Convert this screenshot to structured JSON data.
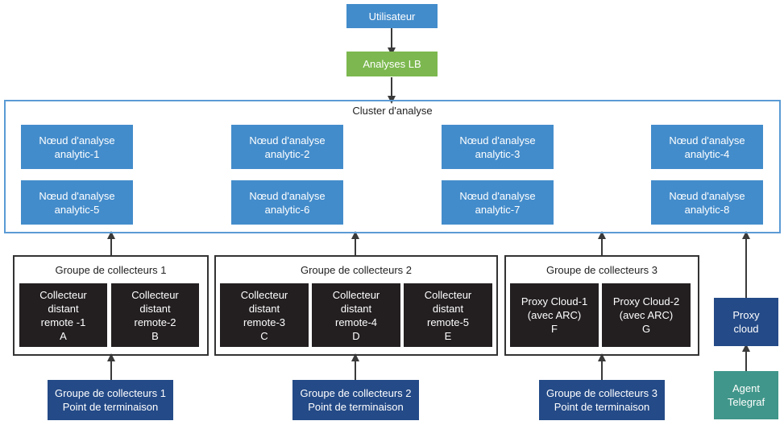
{
  "user": {
    "label": "Utilisateur"
  },
  "load_balancer": {
    "label": "Analyses LB"
  },
  "cluster": {
    "title": "Cluster d'analyse",
    "nodes": [
      {
        "line1": "Nœud d'analyse",
        "line2": "analytic-1"
      },
      {
        "line1": "Nœud d'analyse",
        "line2": "analytic-2"
      },
      {
        "line1": "Nœud d'analyse",
        "line2": "analytic-3"
      },
      {
        "line1": "Nœud d'analyse",
        "line2": "analytic-4"
      },
      {
        "line1": "Nœud d'analyse",
        "line2": "analytic-5"
      },
      {
        "line1": "Nœud d'analyse",
        "line2": "analytic-6"
      },
      {
        "line1": "Nœud d'analyse",
        "line2": "analytic-7"
      },
      {
        "line1": "Nœud d'analyse",
        "line2": "analytic-8"
      }
    ]
  },
  "groups": [
    {
      "title": "Groupe de collecteurs 1",
      "collectors": [
        {
          "lines": [
            "Collecteur",
            "distant",
            "remote -1",
            "A"
          ]
        },
        {
          "lines": [
            "Collecteur",
            "distant",
            "remote-2",
            "B"
          ]
        }
      ],
      "endpoint": {
        "line1": "Groupe de collecteurs 1",
        "line2": "Point de terminaison"
      }
    },
    {
      "title": "Groupe de collecteurs 2",
      "collectors": [
        {
          "lines": [
            "Collecteur",
            "distant",
            "remote-3",
            "C"
          ]
        },
        {
          "lines": [
            "Collecteur",
            "distant",
            "remote-4",
            "D"
          ]
        },
        {
          "lines": [
            "Collecteur",
            "distant",
            "remote-5",
            "E"
          ]
        }
      ],
      "endpoint": {
        "line1": "Groupe de collecteurs 2",
        "line2": "Point de terminaison"
      }
    },
    {
      "title": "Groupe de collecteurs 3",
      "collectors": [
        {
          "lines": [
            "Proxy Cloud-1",
            "(avec ARC)",
            "F"
          ]
        },
        {
          "lines": [
            "Proxy Cloud-2",
            "(avec ARC)",
            "G"
          ]
        }
      ],
      "endpoint": {
        "line1": "Groupe de collecteurs 3",
        "line2": "Point de terminaison"
      }
    }
  ],
  "cloud_proxy": {
    "line1": "Proxy",
    "line2": "cloud"
  },
  "telegraf": {
    "line1": "Agent",
    "line2": "Telegraf"
  },
  "colors": {
    "analytics_blue": "#438ccb",
    "lb_green": "#7cb84f",
    "endpoint_navy": "#244a87",
    "agent_teal": "#40968a",
    "collector_black": "#231f20",
    "cluster_border": "#5b9bd5",
    "arrow": "#3a3a3a"
  }
}
